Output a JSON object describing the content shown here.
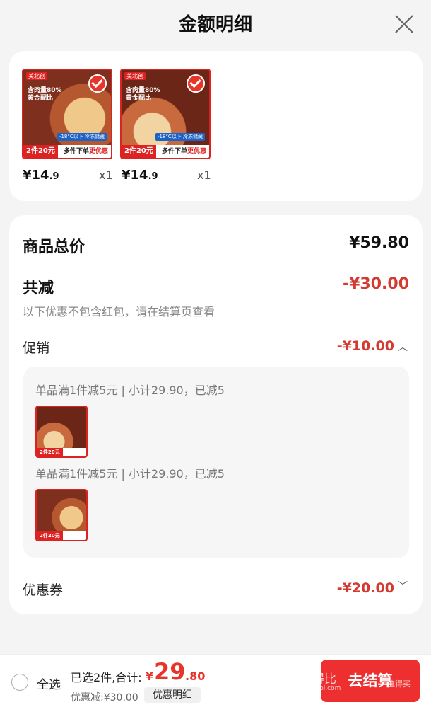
{
  "header": {
    "title": "金额明细"
  },
  "items": [
    {
      "price_int": "¥14",
      "price_dec": ".9",
      "qty": "x1",
      "thumb": {
        "brand": "美北创",
        "headline1": "含肉量80%",
        "headline2": "黄金配比",
        "temp": "-18°C以下 冷冻储藏",
        "price_tag": "2件20元",
        "band_text": "多件下单",
        "band_text_em": "更优惠"
      }
    },
    {
      "price_int": "¥14",
      "price_dec": ".9",
      "qty": "x1",
      "thumb": {
        "brand": "美北创",
        "headline1": "含肉量80%",
        "headline2": "黄金配比",
        "temp": "-18°C以下 冷冻储藏",
        "price_tag": "2件20元",
        "band_text": "多件下单",
        "band_text_em": "更优惠"
      }
    }
  ],
  "summary": {
    "total_label": "商品总价",
    "total_value": "¥59.80",
    "reduce_label": "共减",
    "reduce_value": "-¥30.00",
    "note": "以下优惠不包含红包，请在结算页查看",
    "promo_label": "促销",
    "promo_value": "-¥10.00",
    "promo_lines": [
      "单品满1件减5元 | 小计29.90，已减5",
      "单品满1件减5元 | 小计29.90，已减5"
    ],
    "coupon_label": "优惠券",
    "coupon_value": "-¥20.00"
  },
  "bottom": {
    "select_all": "全选",
    "selected_text": "已选2件,合计:",
    "total_currency": "¥",
    "total_int": "29",
    "total_dec": ".80",
    "discount_text": "优惠减:¥30.00",
    "detail_button": "优惠明细",
    "checkout_button": "去结算",
    "watermark": "没得比",
    "watermark_url": "Meidebi.com",
    "watermark_right": "值得买"
  },
  "colors": {
    "accent": "#ee2f2f",
    "discount": "#d43a2f"
  }
}
